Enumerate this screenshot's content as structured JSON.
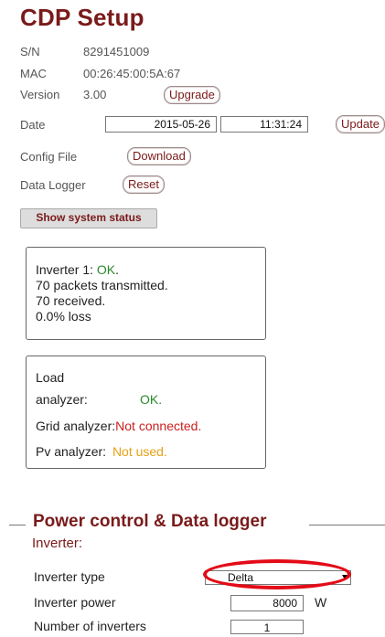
{
  "header": {
    "title": "CDP Setup"
  },
  "info": {
    "sn_label": "S/N",
    "sn_value": "8291451009",
    "mac_label": "MAC",
    "mac_value": "00:26:45:00:5A:67",
    "version_label": "Version",
    "version_value": "3.00",
    "upgrade_label": "Upgrade",
    "date_label": "Date",
    "date_value": "2015-05-26",
    "time_value": "11:31:24",
    "update_label": "Update",
    "config_label": "Config File",
    "download_label": "Download",
    "logger_label": "Data Logger",
    "reset_label": "Reset",
    "system_status_label": "Show system status"
  },
  "inverter_status": {
    "prefix": "Inverter 1: ",
    "status": "OK",
    "status_suffix": ".",
    "line2": "70 packets transmitted.",
    "line3": "70 received.",
    "line4": "0.0% loss"
  },
  "analyzers": {
    "load_label_1": "Load",
    "load_label_2": "analyzer:",
    "load_status": "OK",
    "grid_label": "Grid analyzer:",
    "grid_status": "Not connected",
    "pv_label": "Pv analyzer:",
    "pv_status": "Not used",
    "dot": "."
  },
  "power_control": {
    "legend": "Power control & Data logger",
    "section": "Inverter:",
    "type_label": "Inverter type",
    "type_value": "Delta",
    "power_label": "Inverter power",
    "power_value": "8000",
    "power_unit": "W",
    "count_label": "Number of inverters",
    "count_value": "1"
  },
  "colors": {
    "accent": "#7a1a1a",
    "ok": "#2b8a2b",
    "error": "#c91f1f",
    "warning": "#e6a115",
    "highlight_ring": "#e30b17"
  }
}
